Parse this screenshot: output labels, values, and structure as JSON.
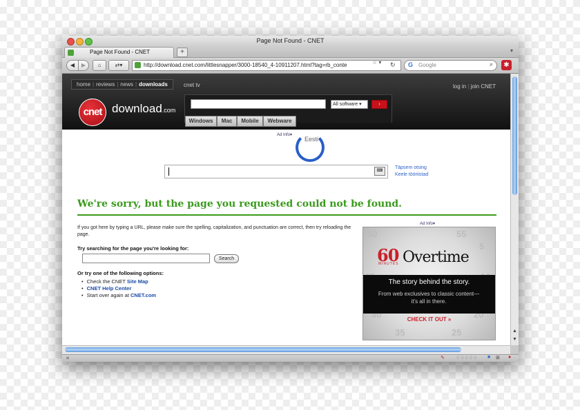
{
  "window": {
    "title": "Page Not Found - CNET",
    "tab_label": "Page Not Found - CNET",
    "new_tab": "+",
    "url": "http://download.cnet.com/littlesnapper/3000-18540_4-10911207.html?tag=rb_conte",
    "search_placeholder": "Google"
  },
  "cnet": {
    "nav": [
      "home",
      "reviews",
      "news",
      "downloads"
    ],
    "nav_active": "downloads",
    "cnet_tv": "cnet tv",
    "login": "log in",
    "join": "join CNET",
    "logo_circle": "cnet",
    "logo_download": "download",
    "logo_com": ".com",
    "software_select": "All software",
    "platforms": [
      "Windows",
      "Mac",
      "Mobile",
      "Webware"
    ]
  },
  "ad_info": "Ad Info",
  "google": {
    "eesti": "Eesti",
    "advanced": "Täpsem otsing",
    "language_tools": "Keele tööriistad"
  },
  "error": {
    "heading": "We're sorry, but the page you requested could not be found.",
    "body": "If you got here by typing a URL, please make sure the spelling, capitalization, and punctuation are correct, then try reloading the page.",
    "try_label": "Try searching for the page you're looking for:",
    "search_button": "Search",
    "or_label": "Or try one of the following options:",
    "options": [
      {
        "prefix": "Check the CNET ",
        "link": "Site Map"
      },
      {
        "prefix": "",
        "link": "CNET Help Center"
      },
      {
        "prefix": "Start over again at ",
        "link": "CNET.com"
      }
    ]
  },
  "ad": {
    "sixty": "60",
    "minutes": "MINUTES",
    "overtime": "Overtime",
    "story": "The story behind the story.",
    "sub": "From web exclusives to classic content—it's all in there.",
    "cta": "CHECK IT OUT »",
    "dial_numbers": [
      "55",
      "5",
      "50",
      "10",
      "45",
      "15",
      "40",
      "20",
      "35",
      "25"
    ]
  },
  "colors": {
    "cnet_red": "#c8111a",
    "heading_green": "#3a9a1d",
    "link_blue": "#1a4aa8"
  }
}
